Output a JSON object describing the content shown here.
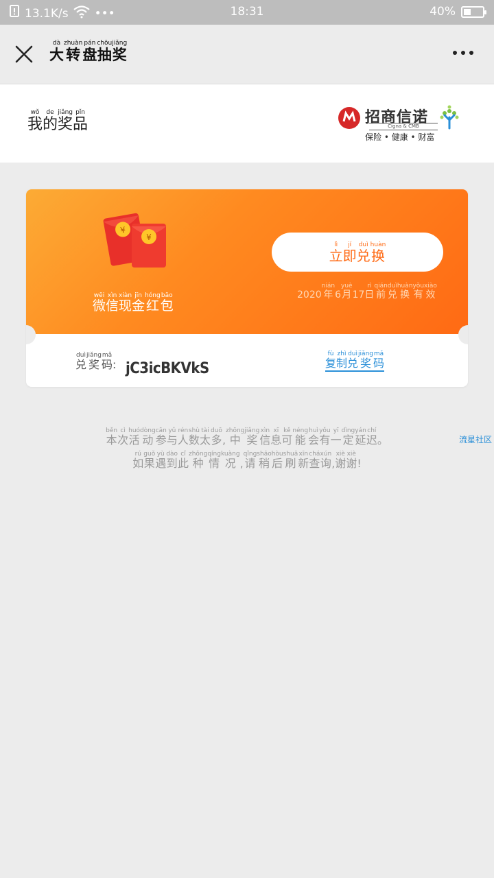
{
  "status_bar": {
    "speed": "13.1K/s",
    "dots": "•••",
    "time": "18:31",
    "battery": "40%",
    "battery_level": 0.4
  },
  "nav": {
    "title_chars": [
      {
        "py": "dà",
        "ch": "大"
      },
      {
        "py": "zhuàn",
        "ch": "转"
      },
      {
        "py": "pán",
        "ch": "盘"
      },
      {
        "py": "chōu",
        "ch": "抽"
      },
      {
        "py": "jiǎng",
        "ch": "奖"
      }
    ]
  },
  "header": {
    "title_chars": [
      {
        "py": "wǒ",
        "ch": "我"
      },
      {
        "py": "de",
        "ch": "的"
      },
      {
        "py": "jiǎng",
        "ch": "奖"
      },
      {
        "py": "pǐn",
        "ch": "品"
      }
    ],
    "brand_name": "招商信诺",
    "brand_sub": "Cigna & CMB",
    "brand_tagline": "保险 • 健康 • 财富"
  },
  "prize": {
    "name_chars": [
      {
        "py": "wēi",
        "ch": "微"
      },
      {
        "py": "xìn",
        "ch": "信"
      },
      {
        "py": "xiàn",
        "ch": "现"
      },
      {
        "py": "jīn",
        "ch": "金"
      },
      {
        "py": "hóng",
        "ch": "红"
      },
      {
        "py": "bāo",
        "ch": "包"
      }
    ],
    "redeem_chars": [
      {
        "py": "lì",
        "ch": "立"
      },
      {
        "py": "jí",
        "ch": "即"
      },
      {
        "py": "duì",
        "ch": "兑"
      },
      {
        "py": "huàn",
        "ch": "换"
      }
    ],
    "expiry_chars": [
      {
        "py": "",
        "ch": "2020"
      },
      {
        "py": "nián",
        "ch": "年"
      },
      {
        "py": "",
        "ch": "6"
      },
      {
        "py": "yuè",
        "ch": "月"
      },
      {
        "py": "",
        "ch": "17"
      },
      {
        "py": "rì",
        "ch": "日"
      },
      {
        "py": "qián",
        "ch": "前"
      },
      {
        "py": "duì",
        "ch": "兑"
      },
      {
        "py": "huàn",
        "ch": "换"
      },
      {
        "py": "yǒu",
        "ch": "有"
      },
      {
        "py": "xiào",
        "ch": "效"
      }
    ],
    "code_label_chars": [
      {
        "py": "duì",
        "ch": "兑"
      },
      {
        "py": "jiǎng",
        "ch": "奖"
      },
      {
        "py": "mǎ",
        "ch": "码"
      },
      {
        "py": "",
        "ch": ":"
      }
    ],
    "code": "jC3icBKVkS",
    "copy_chars": [
      {
        "py": "fù",
        "ch": "复"
      },
      {
        "py": "zhì",
        "ch": "制"
      },
      {
        "py": "duì",
        "ch": "兑"
      },
      {
        "py": "jiǎng",
        "ch": "奖"
      },
      {
        "py": "mǎ",
        "ch": "码"
      }
    ],
    "coin_symbol": "¥"
  },
  "notice": {
    "line1": [
      {
        "py": "běn",
        "ch": "本"
      },
      {
        "py": "cì",
        "ch": "次"
      },
      {
        "py": "huó",
        "ch": "活"
      },
      {
        "py": "dòng",
        "ch": "动"
      },
      {
        "py": "cān",
        "ch": "参"
      },
      {
        "py": "yǔ",
        "ch": "与"
      },
      {
        "py": "rén",
        "ch": "人"
      },
      {
        "py": "shù",
        "ch": "数"
      },
      {
        "py": "tài",
        "ch": "太"
      },
      {
        "py": "duō",
        "ch": "多"
      },
      {
        "py": "",
        "ch": ","
      },
      {
        "py": "zhōng",
        "ch": "中"
      },
      {
        "py": "jiǎng",
        "ch": "奖"
      },
      {
        "py": "xìn",
        "ch": "信"
      },
      {
        "py": "xī",
        "ch": "息"
      },
      {
        "py": "kě",
        "ch": "可"
      },
      {
        "py": "néng",
        "ch": "能"
      },
      {
        "py": "huì",
        "ch": "会"
      },
      {
        "py": "yǒu",
        "ch": "有"
      },
      {
        "py": "yī",
        "ch": "一"
      },
      {
        "py": "dìng",
        "ch": "定"
      },
      {
        "py": "yán",
        "ch": "延"
      },
      {
        "py": "chí",
        "ch": "迟"
      },
      {
        "py": "",
        "ch": "。"
      }
    ],
    "line2": [
      {
        "py": "rú",
        "ch": "如"
      },
      {
        "py": "guǒ",
        "ch": "果"
      },
      {
        "py": "yù",
        "ch": "遇"
      },
      {
        "py": "dào",
        "ch": "到"
      },
      {
        "py": "cǐ",
        "ch": "此"
      },
      {
        "py": "zhǒng",
        "ch": "种"
      },
      {
        "py": "qíng",
        "ch": "情"
      },
      {
        "py": "kuàng",
        "ch": "况"
      },
      {
        "py": "",
        "ch": ","
      },
      {
        "py": "qǐng",
        "ch": "请"
      },
      {
        "py": "shāo",
        "ch": "稍"
      },
      {
        "py": "hòu",
        "ch": "后"
      },
      {
        "py": "shuā",
        "ch": "刷"
      },
      {
        "py": "xīn",
        "ch": "新"
      },
      {
        "py": "chá",
        "ch": "查"
      },
      {
        "py": "xún",
        "ch": "询"
      },
      {
        "py": "",
        "ch": ","
      },
      {
        "py": "xiè",
        "ch": "谢"
      },
      {
        "py": "xiè",
        "ch": "谢"
      },
      {
        "py": "",
        "ch": "!"
      }
    ],
    "side_link": "流星社区"
  }
}
